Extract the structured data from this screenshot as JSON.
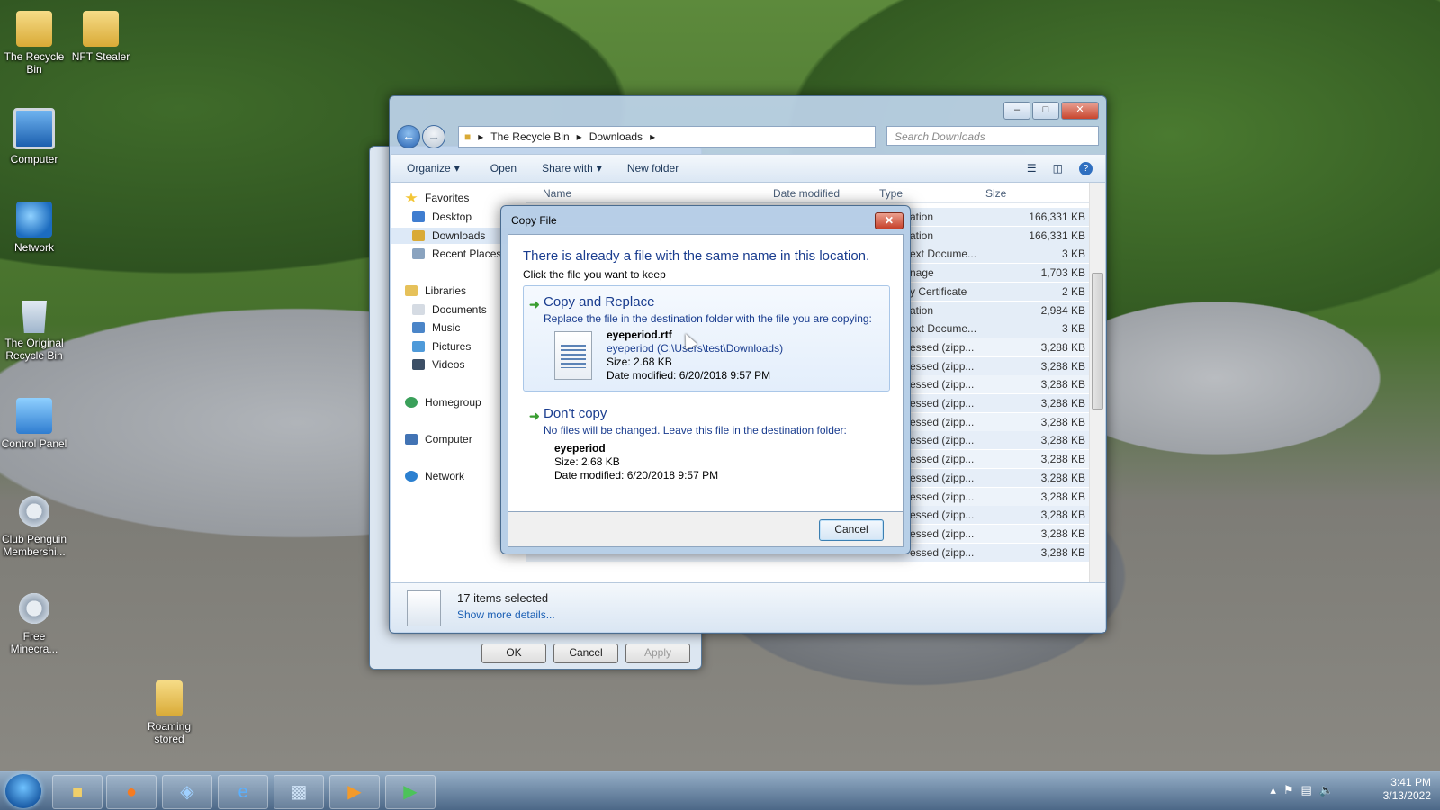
{
  "desktop": {
    "icons": [
      {
        "label": "The Recycle Bin"
      },
      {
        "label": "NFT Stealer"
      },
      {
        "label": "Computer"
      },
      {
        "label": "Network"
      },
      {
        "label": "The Original Recycle Bin"
      },
      {
        "label": "Control Panel"
      },
      {
        "label": "Club Penguin Membershi..."
      },
      {
        "label": "Free Minecra..."
      },
      {
        "label": "Roaming stored"
      }
    ]
  },
  "explorer": {
    "breadcrumb": [
      "The Recycle Bin",
      "Downloads"
    ],
    "search_placeholder": "Search Downloads",
    "toolbar": {
      "organize": "Organize",
      "open": "Open",
      "share": "Share with",
      "new_folder": "New folder"
    },
    "nav": {
      "favorites": "Favorites",
      "desktop": "Desktop",
      "downloads": "Downloads",
      "recent": "Recent Places",
      "libraries": "Libraries",
      "documents": "Documents",
      "music": "Music",
      "pictures": "Pictures",
      "videos": "Videos",
      "homegroup": "Homegroup",
      "computer": "Computer",
      "network": "Network"
    },
    "columns": {
      "name": "Name",
      "date": "Date modified",
      "type": "Type",
      "size": "Size"
    },
    "rows": [
      {
        "type": "ation",
        "size": "166,331 KB"
      },
      {
        "type": "ation",
        "size": "166,331 KB"
      },
      {
        "type": "ext Docume...",
        "size": "3 KB"
      },
      {
        "type": "nage",
        "size": "1,703 KB"
      },
      {
        "type": "y Certificate",
        "size": "2 KB"
      },
      {
        "type": "ation",
        "size": "2,984 KB"
      },
      {
        "type": "ext Docume...",
        "size": "3 KB"
      },
      {
        "type": "essed (zipp...",
        "size": "3,288 KB"
      },
      {
        "type": "essed (zipp...",
        "size": "3,288 KB"
      },
      {
        "type": "essed (zipp...",
        "size": "3,288 KB"
      },
      {
        "type": "essed (zipp...",
        "size": "3,288 KB"
      },
      {
        "type": "essed (zipp...",
        "size": "3,288 KB"
      },
      {
        "type": "essed (zipp...",
        "size": "3,288 KB"
      },
      {
        "type": "essed (zipp...",
        "size": "3,288 KB"
      },
      {
        "type": "essed (zipp...",
        "size": "3,288 KB"
      },
      {
        "type": "essed (zipp...",
        "size": "3,288 KB"
      },
      {
        "type": "essed (zipp...",
        "size": "3,288 KB"
      },
      {
        "type": "essed (zipp...",
        "size": "3,288 KB"
      },
      {
        "type": "essed (zipp...",
        "size": "3,288 KB"
      }
    ],
    "status": {
      "selected": "17 items selected",
      "more": "Show more details..."
    }
  },
  "props_dialog": {
    "ok": "OK",
    "cancel": "Cancel",
    "apply": "Apply"
  },
  "copy_dialog": {
    "title": "Copy File",
    "heading": "There is already a file with the same name in this location.",
    "subheading": "Click the file you want to keep",
    "replace": {
      "title": "Copy and Replace",
      "desc": "Replace the file in the destination folder with the file you are copying:",
      "filename": "eyeperiod.rtf",
      "path": "eyeperiod (C:\\Users\\test\\Downloads)",
      "size": "Size: 2.68 KB",
      "modified": "Date modified: 6/20/2018 9:57 PM"
    },
    "dont": {
      "title": "Don't copy",
      "desc": "No files will be changed. Leave this file in the destination folder:",
      "filename": "eyeperiod",
      "size": "Size: 2.68 KB",
      "modified": "Date modified: 6/20/2018 9:57 PM"
    },
    "cancel": "Cancel"
  },
  "taskbar": {
    "time": "3:41 PM",
    "date": "3/13/2022"
  }
}
